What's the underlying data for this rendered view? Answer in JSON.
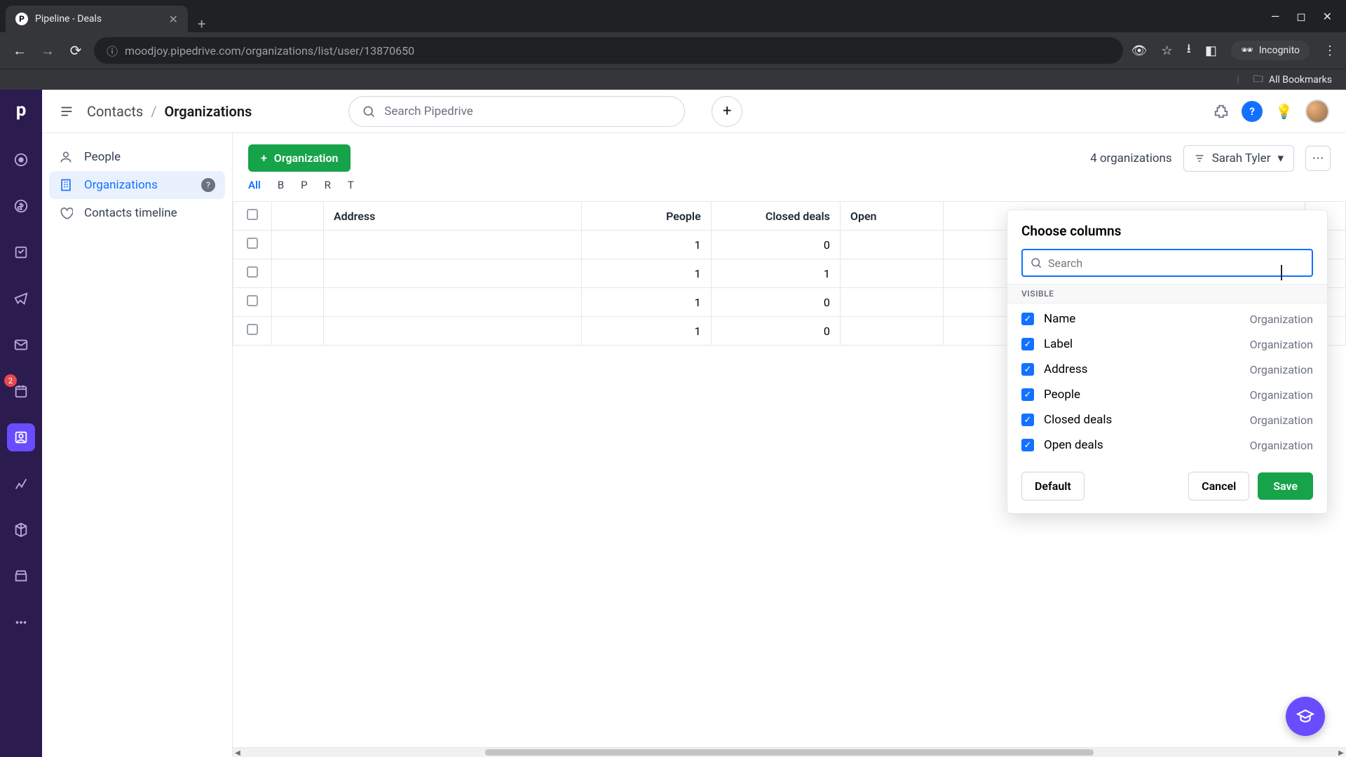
{
  "browser": {
    "tab_title": "Pipeline - Deals",
    "url": "moodjoy.pipedrive.com/organizations/list/user/13870650",
    "incognito_label": "Incognito",
    "bookmarks_label": "All Bookmarks"
  },
  "breadcrumb": {
    "root": "Contacts",
    "current": "Organizations"
  },
  "search": {
    "placeholder": "Search Pipedrive"
  },
  "sidebar": {
    "items": [
      {
        "label": "People"
      },
      {
        "label": "Organizations"
      },
      {
        "label": "Contacts timeline"
      }
    ]
  },
  "toolbar": {
    "add_label": "Organization",
    "count_text": "4 organizations",
    "filter_user": "Sarah Tyler"
  },
  "alpha_filters": [
    "All",
    "B",
    "P",
    "R",
    "T"
  ],
  "table": {
    "headers": {
      "address": "Address",
      "people": "People",
      "closed": "Closed deals",
      "open": "Open"
    },
    "rows": [
      {
        "address": "",
        "people": 1,
        "closed": 0
      },
      {
        "address": "",
        "people": 1,
        "closed": 1
      },
      {
        "address": "",
        "people": 1,
        "closed": 0
      },
      {
        "address": "",
        "people": 1,
        "closed": 0
      }
    ]
  },
  "popover": {
    "title": "Choose columns",
    "search_placeholder": "Search",
    "section_label": "VISIBLE",
    "items": [
      {
        "label": "Name",
        "group": "Organization",
        "checked": true
      },
      {
        "label": "Label",
        "group": "Organization",
        "checked": true
      },
      {
        "label": "Address",
        "group": "Organization",
        "checked": true
      },
      {
        "label": "People",
        "group": "Organization",
        "checked": true
      },
      {
        "label": "Closed deals",
        "group": "Organization",
        "checked": true
      },
      {
        "label": "Open deals",
        "group": "Organization",
        "checked": true
      }
    ],
    "default_label": "Default",
    "cancel_label": "Cancel",
    "save_label": "Save"
  },
  "rail": {
    "badge": "2"
  }
}
